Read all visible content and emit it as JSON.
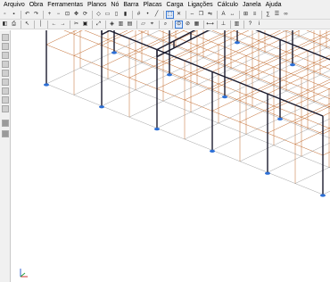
{
  "menu": [
    {
      "label": "Arquivo"
    },
    {
      "label": "Obra"
    },
    {
      "label": "Ferramentas"
    },
    {
      "label": "Planos"
    },
    {
      "label": "Nó"
    },
    {
      "label": "Barra"
    },
    {
      "label": "Placas"
    },
    {
      "label": "Carga"
    },
    {
      "label": "Ligações"
    },
    {
      "label": "Cálculo"
    },
    {
      "label": "Janela"
    },
    {
      "label": "Ajuda"
    }
  ],
  "toolbar1": [
    "new-icon",
    "save-icon",
    "sep",
    "undo-icon",
    "redo-icon",
    "sep",
    "zoom-in-icon",
    "zoom-out-icon",
    "zoom-window-icon",
    "pan-icon",
    "rotate-icon",
    "sep",
    "view-3d-icon",
    "view-top-icon",
    "view-front-icon",
    "view-side-icon",
    "sep",
    "grid-icon",
    "node-icon",
    "bar-icon",
    "sep",
    "select-icon",
    "erase-icon",
    "sep",
    "move-icon",
    "copy-icon",
    "mirror-icon",
    "sep",
    "text-icon",
    "dimension-icon",
    "sep",
    "zoom-all-icon",
    "layer-icon",
    "sep",
    "calc-icon",
    "report-icon",
    "binoculars-icon"
  ],
  "toolbar2": [
    "open-icon",
    "print-icon",
    "sep",
    "arrow-icon",
    "sep",
    "vertical-icon",
    "sep",
    "arrow-left-icon",
    "arrow-right-icon",
    "sep",
    "cut-icon",
    "paste-icon",
    "sep",
    "zoom-extents-icon",
    "sep",
    "3d-cube-icon",
    "front-icon",
    "top-icon",
    "sep",
    "plane-icon",
    "snap-icon",
    "sep",
    "magnify-icon",
    "sep",
    "node-select-icon",
    "bar-select-icon",
    "plate-select-icon",
    "sep",
    "measure-icon",
    "sep",
    "pin-icon",
    "sep",
    "chart-icon",
    "sep",
    "help-icon",
    "info-icon"
  ],
  "colors": {
    "frame": "#1b1b2e",
    "beam_orange": "#c0682a",
    "support": "#2c6fd6",
    "background": "#ffffff"
  }
}
